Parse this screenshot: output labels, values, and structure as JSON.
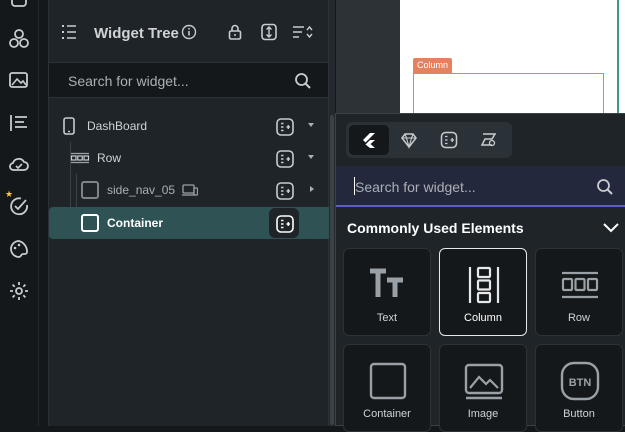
{
  "rail": {
    "icons": [
      "component-icon",
      "media-icon",
      "storyboard-icon",
      "cloud-icon",
      "check-star-icon",
      "palette-icon",
      "settings-icon"
    ]
  },
  "tree": {
    "title": "Widget Tree",
    "search_placeholder": "Search for widget...",
    "items": [
      {
        "label": "DashBoard"
      },
      {
        "label": "Row"
      },
      {
        "label": "side_nav_05"
      },
      {
        "label": "Container"
      }
    ]
  },
  "canvas": {
    "column_tag": "Column"
  },
  "popup": {
    "search_placeholder": "Search for widget...",
    "section_title": "Commonly Used Elements",
    "tiles": [
      {
        "label": "Text"
      },
      {
        "label": "Column"
      },
      {
        "label": "Row"
      },
      {
        "label": "Container"
      },
      {
        "label": "Image"
      },
      {
        "label": "Button"
      }
    ],
    "button_icon_text": "BTN"
  },
  "colors": {
    "accent_selected": "#2f5254",
    "search_focus": "#5b5fc7",
    "column_tag": "#e4825f"
  }
}
